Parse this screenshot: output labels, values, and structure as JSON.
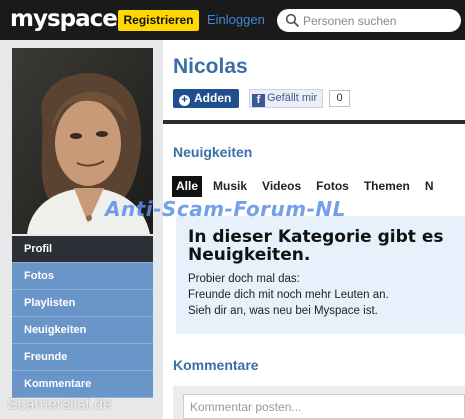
{
  "header": {
    "logo": "myspace",
    "register_label": "Registrieren",
    "login_label": "Einloggen",
    "search_placeholder": "Personen suchen"
  },
  "profile": {
    "name": "Nicolas",
    "add_label": "Adden",
    "fb_like_label": "Gefällt mir",
    "fb_like_count": "0"
  },
  "sidebar": {
    "items": [
      {
        "label": "Profil",
        "active": true
      },
      {
        "label": "Fotos"
      },
      {
        "label": "Playlisten"
      },
      {
        "label": "Neuigkeiten"
      },
      {
        "label": "Freunde"
      },
      {
        "label": "Kommentare"
      }
    ]
  },
  "news": {
    "title": "Neuigkeiten",
    "tabs": [
      "Alle",
      "Musik",
      "Videos",
      "Fotos",
      "Themen",
      "N"
    ],
    "empty_heading_1": "In dieser Kategorie gibt es",
    "empty_heading_2": "Neuigkeiten.",
    "suggest_intro": "Probier doch mal das:",
    "suggest_1": "Freunde dich mit noch mehr Leuten an.",
    "suggest_2": "Sieh dir an, was neu bei Myspace ist."
  },
  "comments": {
    "title": "Kommentare",
    "placeholder": "Kommentar posten..."
  },
  "watermarks": {
    "forum": "Anti-Scam-Forum-NL",
    "site": "Scamerslist.de"
  },
  "colors": {
    "accent_blue": "#3a6fa8",
    "register_yellow": "#ffd800",
    "nav_blue": "#6a95c9"
  }
}
